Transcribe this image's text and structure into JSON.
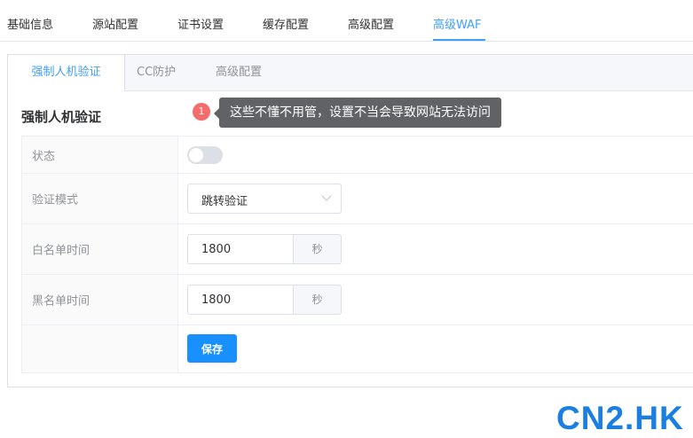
{
  "top_tabs": [
    {
      "label": "基础信息"
    },
    {
      "label": "源站配置"
    },
    {
      "label": "证书设置"
    },
    {
      "label": "缓存配置"
    },
    {
      "label": "高级配置"
    },
    {
      "label": "高级WAF"
    }
  ],
  "active_top_tab": "高级WAF",
  "sub_tabs": [
    {
      "label": "强制人机验证"
    },
    {
      "label": "CC防护"
    },
    {
      "label": "高级配置"
    }
  ],
  "active_sub_tab": "强制人机验证",
  "section": {
    "title": "强制人机验证"
  },
  "annotation": {
    "badge": "1",
    "text": "这些不懂不用管，设置不当会导致网站无法访问"
  },
  "form": {
    "status": {
      "label": "状态",
      "enabled": false
    },
    "mode": {
      "label": "验证模式",
      "value": "跳转验证"
    },
    "whitelist_time": {
      "label": "白名单时间",
      "value": "1800",
      "unit": "秒"
    },
    "blacklist_time": {
      "label": "黑名单时间",
      "value": "1800",
      "unit": "秒"
    },
    "save_label": "保存"
  },
  "watermark": "CN2.HK",
  "colors": {
    "accent": "#409eff",
    "button": "#1890ff",
    "badge": "#f56c6c",
    "tooltip": "#606266",
    "watermark": "#1a7fe0"
  }
}
